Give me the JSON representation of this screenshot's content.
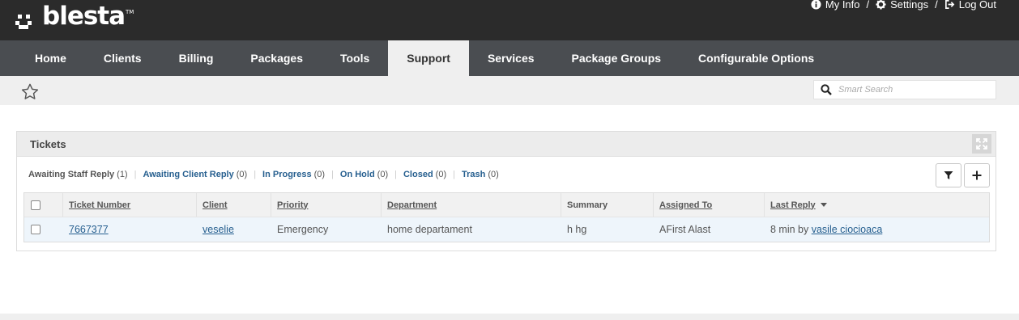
{
  "brand": {
    "name": "blesta",
    "tm": "TM"
  },
  "toplinks": [
    {
      "label": "My Info",
      "icon": "info-circle-icon"
    },
    {
      "label": "Settings",
      "icon": "gear-icon"
    },
    {
      "label": "Log Out",
      "icon": "logout-icon"
    }
  ],
  "toplinks_sep": "/",
  "nav": [
    {
      "label": "Home"
    },
    {
      "label": "Clients"
    },
    {
      "label": "Billing"
    },
    {
      "label": "Packages"
    },
    {
      "label": "Tools"
    },
    {
      "label": "Support",
      "active": true
    },
    {
      "label": "Services"
    },
    {
      "label": "Package Groups"
    },
    {
      "label": "Configurable Options"
    }
  ],
  "search": {
    "placeholder": "Smart Search"
  },
  "panel": {
    "title": "Tickets",
    "filters": [
      {
        "label": "Awaiting Staff Reply",
        "count": "(1)",
        "active": true
      },
      {
        "label": "Awaiting Client Reply",
        "count": "(0)"
      },
      {
        "label": "In Progress",
        "count": "(0)"
      },
      {
        "label": "On Hold",
        "count": "(0)"
      },
      {
        "label": "Closed",
        "count": "(0)"
      },
      {
        "label": "Trash",
        "count": "(0)"
      }
    ],
    "filter_sep": "|"
  },
  "table": {
    "headers": {
      "ticket_number": "Ticket Number",
      "client": "Client",
      "priority": "Priority",
      "department": "Department",
      "summary": "Summary",
      "assigned_to": "Assigned To",
      "last_reply": "Last Reply"
    },
    "rows": [
      {
        "ticket_number": "7667377",
        "client": "veselie",
        "priority": "Emergency",
        "department": "home departament",
        "summary": "h hg",
        "assigned_to": "AFirst Alast",
        "last_reply_prefix": "8 min by",
        "last_reply_by": "vasile ciocioaca"
      }
    ]
  },
  "colors": {
    "topbar": "#2b2b2b",
    "nav": "#4a4d51",
    "link": "#265f8f"
  }
}
